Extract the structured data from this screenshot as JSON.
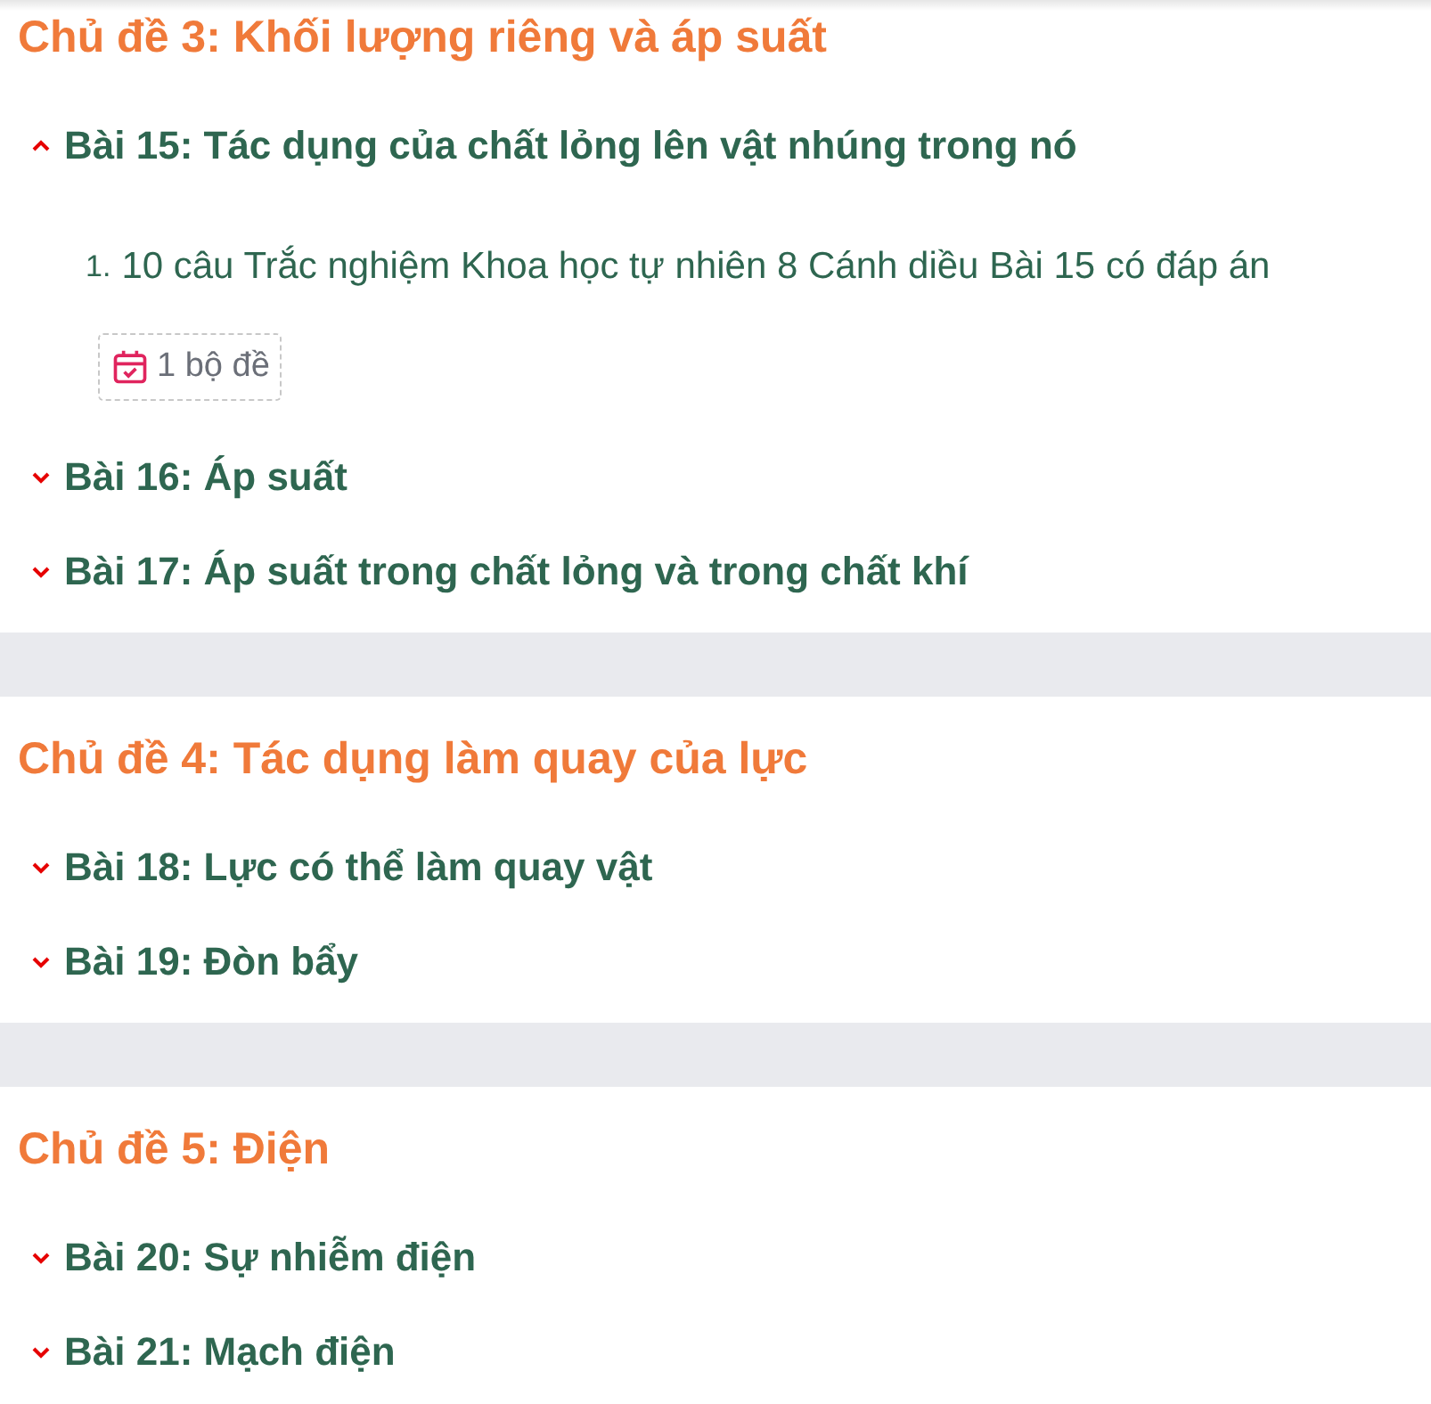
{
  "topics": [
    {
      "title": "Chủ đề 3: Khối lượng riêng và áp suất",
      "lessons": [
        {
          "title": "Bài 15: Tác dụng của chất lỏng lên vật nhúng trong nó",
          "expanded": true,
          "items": [
            {
              "number": "1.",
              "title": "10 câu Trắc nghiệm Khoa học tự nhiên 8 Cánh diều Bài 15 có đáp án",
              "badge": "1 bộ đề"
            }
          ]
        },
        {
          "title": "Bài 16: Áp suất",
          "expanded": false
        },
        {
          "title": "Bài 17: Áp suất trong chất lỏng và trong chất khí",
          "expanded": false
        }
      ]
    },
    {
      "title": "Chủ đề 4: Tác dụng làm quay của lực",
      "lessons": [
        {
          "title": "Bài 18: Lực có thể làm quay vật",
          "expanded": false
        },
        {
          "title": "Bài 19: Đòn bẩy",
          "expanded": false
        }
      ]
    },
    {
      "title": "Chủ đề 5: Điện",
      "lessons": [
        {
          "title": "Bài 20: Sự nhiễm điện",
          "expanded": false
        },
        {
          "title": "Bài 21: Mạch điện",
          "expanded": false
        }
      ]
    }
  ]
}
